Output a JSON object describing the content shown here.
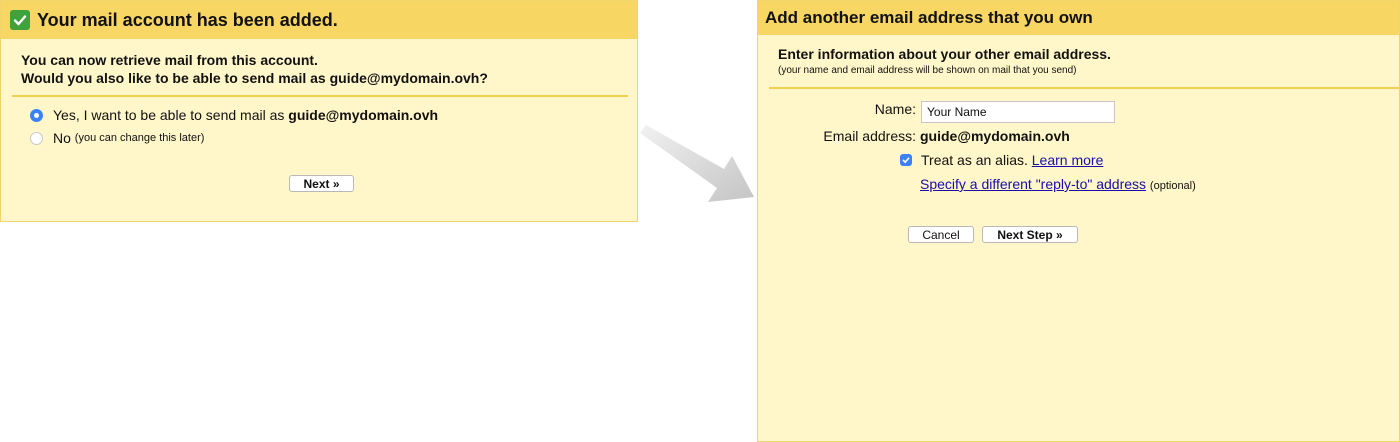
{
  "left_panel": {
    "header": "Your mail account has been added.",
    "line1": "You can now retrieve mail from this account.",
    "line2": "Would you also like to be able to send mail as guide@mydomain.ovh?",
    "option_yes_text": "Yes, I want to be able to send mail as ",
    "option_yes_email": "guide@mydomain.ovh",
    "option_yes_checked": true,
    "option_no_label": "No",
    "option_no_note": "(you can change this later)",
    "next_button": "Next »"
  },
  "right_panel": {
    "header": "Add another email address that you own",
    "subtitle": "Enter information about your other email address.",
    "note": "(your name and email address will be shown on mail that you send)",
    "name_label": "Name:",
    "name_value": "Your Name",
    "email_label": "Email address:",
    "email_value": "guide@mydomain.ovh",
    "alias_text": "Treat as an alias.",
    "alias_checked": true,
    "learn_more": "Learn more",
    "reply_to_link": "Specify a different \"reply-to\" address",
    "reply_to_note": "(optional)",
    "cancel_button": "Cancel",
    "next_step_button": "Next Step »"
  },
  "colors": {
    "header_bg": "#f8d663",
    "panel_bg": "#fff7c9",
    "accent_blue": "#3b82f6",
    "link": "#1a0dab",
    "check_green": "#3fa23a"
  },
  "icons": [
    "check-icon",
    "arrow-icon",
    "radio-icon",
    "checkbox-icon"
  ]
}
